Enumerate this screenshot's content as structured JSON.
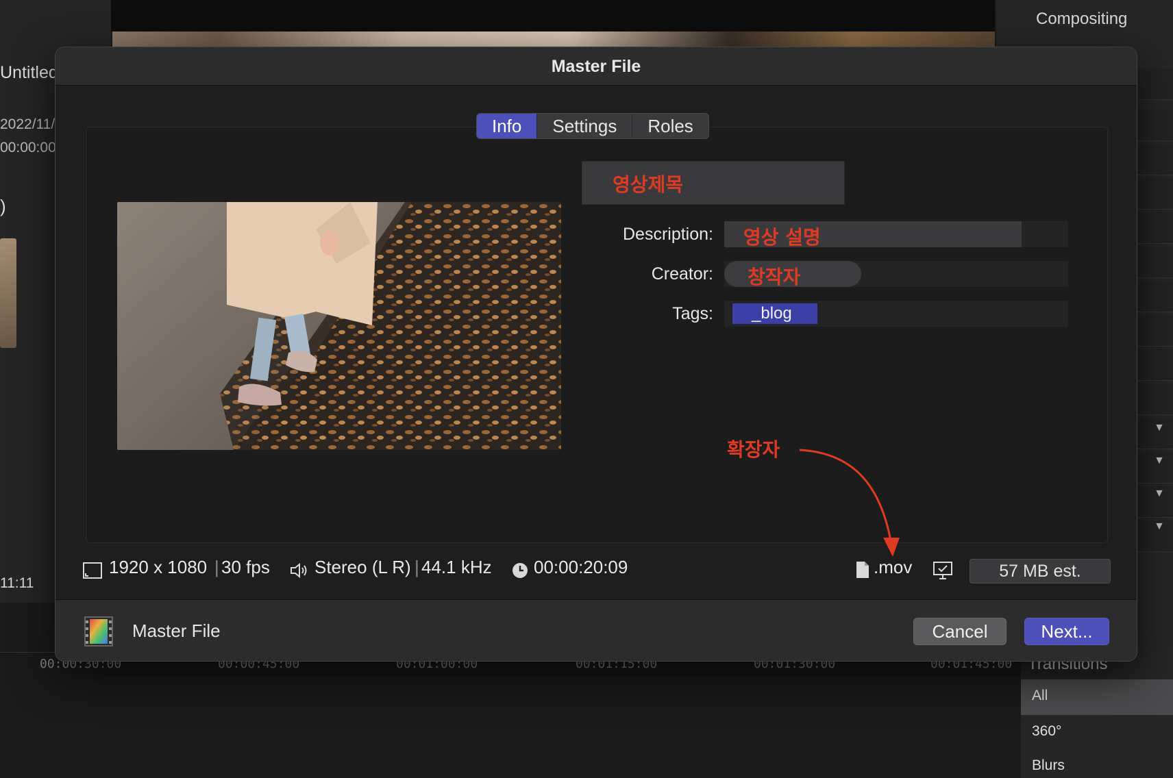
{
  "background": {
    "left_panel": {
      "title": "Untitled",
      "date": "2022/11/",
      "timecode": "00:00:00",
      "bracket": ")",
      "clock": "11:11"
    },
    "right_panel": {
      "title": "Compositing"
    },
    "timeline_ruler": [
      "00:00:30:00",
      "00:00:45:00",
      "00:01:00:00",
      "00:01:15:00",
      "00:01:30:00",
      "00:01:45:00"
    ],
    "transitions": {
      "title": "Transitions",
      "items": [
        "All",
        "360°",
        "Blurs"
      ]
    }
  },
  "dialog": {
    "title": "Master File",
    "tabs": [
      {
        "label": "Info",
        "active": true
      },
      {
        "label": "Settings",
        "active": false
      },
      {
        "label": "Roles",
        "active": false
      }
    ],
    "fields": {
      "name_value": "영상제목",
      "description_label": "Description:",
      "description_value": "영상 설명",
      "creator_label": "Creator:",
      "creator_value": "창작자",
      "tags_label": "Tags:",
      "tags": [
        "_blog"
      ]
    },
    "annotation": {
      "extension_note": "확장자"
    },
    "stats": {
      "resolution": "1920 x 1080",
      "fps": "30 fps",
      "audio": "Stereo (L R)",
      "sample_rate": "44.1 kHz",
      "duration": "00:00:20:09",
      "extension": ".mov",
      "size_estimate": "57 MB est."
    },
    "footer": {
      "title": "Master File",
      "cancel_label": "Cancel",
      "next_label": "Next..."
    }
  },
  "colors": {
    "accent": "#4c50b8",
    "annotation_red": "#e03a25",
    "panel": "#1e1e1f"
  }
}
